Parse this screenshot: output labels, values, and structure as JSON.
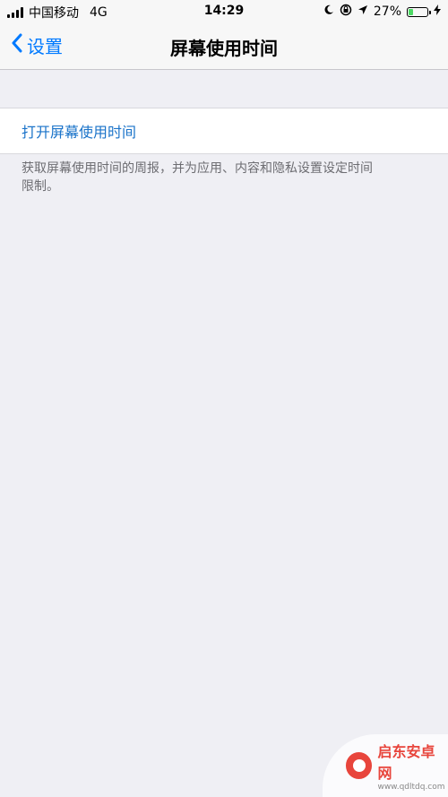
{
  "status_bar": {
    "carrier": "中国移动",
    "network": "4G",
    "time": "14:29",
    "battery_percent_label": "27%",
    "battery_level": 0.27,
    "battery_color": "#4cd964"
  },
  "nav": {
    "back_label": "设置",
    "title": "屏幕使用时间",
    "accent_color": "#007aff"
  },
  "section": {
    "enable_label": "打开屏幕使用时间",
    "footer_text": "获取屏幕使用时间的周报，并为应用、内容和隐私设置设定时间限制。"
  },
  "icons": {
    "back": "chevron-left-icon",
    "signal": "signal-bars-icon",
    "moon": "moon-icon",
    "rotation_lock": "rotation-lock-icon",
    "location": "location-arrow-icon",
    "battery": "battery-icon",
    "charging": "charging-bolt-icon"
  },
  "watermark": {
    "name": "启东安卓网",
    "url": "www.qdltdq.com"
  }
}
